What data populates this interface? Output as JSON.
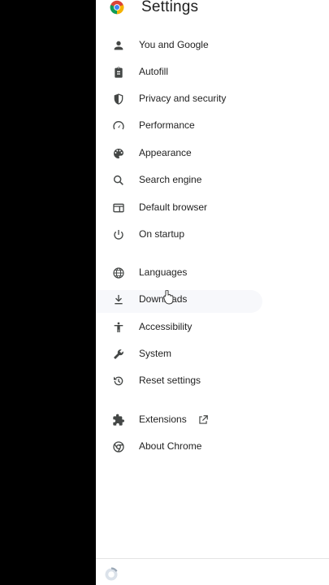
{
  "header": {
    "title": "Settings"
  },
  "menu": [
    {
      "label": "You and Google",
      "icon": "person-icon"
    },
    {
      "label": "Autofill",
      "icon": "clipboard-icon"
    },
    {
      "label": "Privacy and security",
      "icon": "shield-icon"
    },
    {
      "label": "Performance",
      "icon": "speedometer-icon"
    },
    {
      "label": "Appearance",
      "icon": "palette-icon"
    },
    {
      "label": "Search engine",
      "icon": "search-icon"
    },
    {
      "label": "Default browser",
      "icon": "browser-window-icon"
    },
    {
      "label": "On startup",
      "icon": "power-icon"
    },
    {
      "label": "Languages",
      "icon": "globe-icon"
    },
    {
      "label": "Downloads",
      "icon": "download-icon"
    },
    {
      "label": "Accessibility",
      "icon": "accessibility-icon"
    },
    {
      "label": "System",
      "icon": "wrench-icon"
    },
    {
      "label": "Reset settings",
      "icon": "reset-history-icon"
    },
    {
      "label": "Extensions",
      "icon": "puzzle-icon"
    },
    {
      "label": "About Chrome",
      "icon": "chrome-icon"
    }
  ],
  "colors": {
    "icon": "#444746",
    "text": "#1f1f1f",
    "background": "#ffffff"
  }
}
